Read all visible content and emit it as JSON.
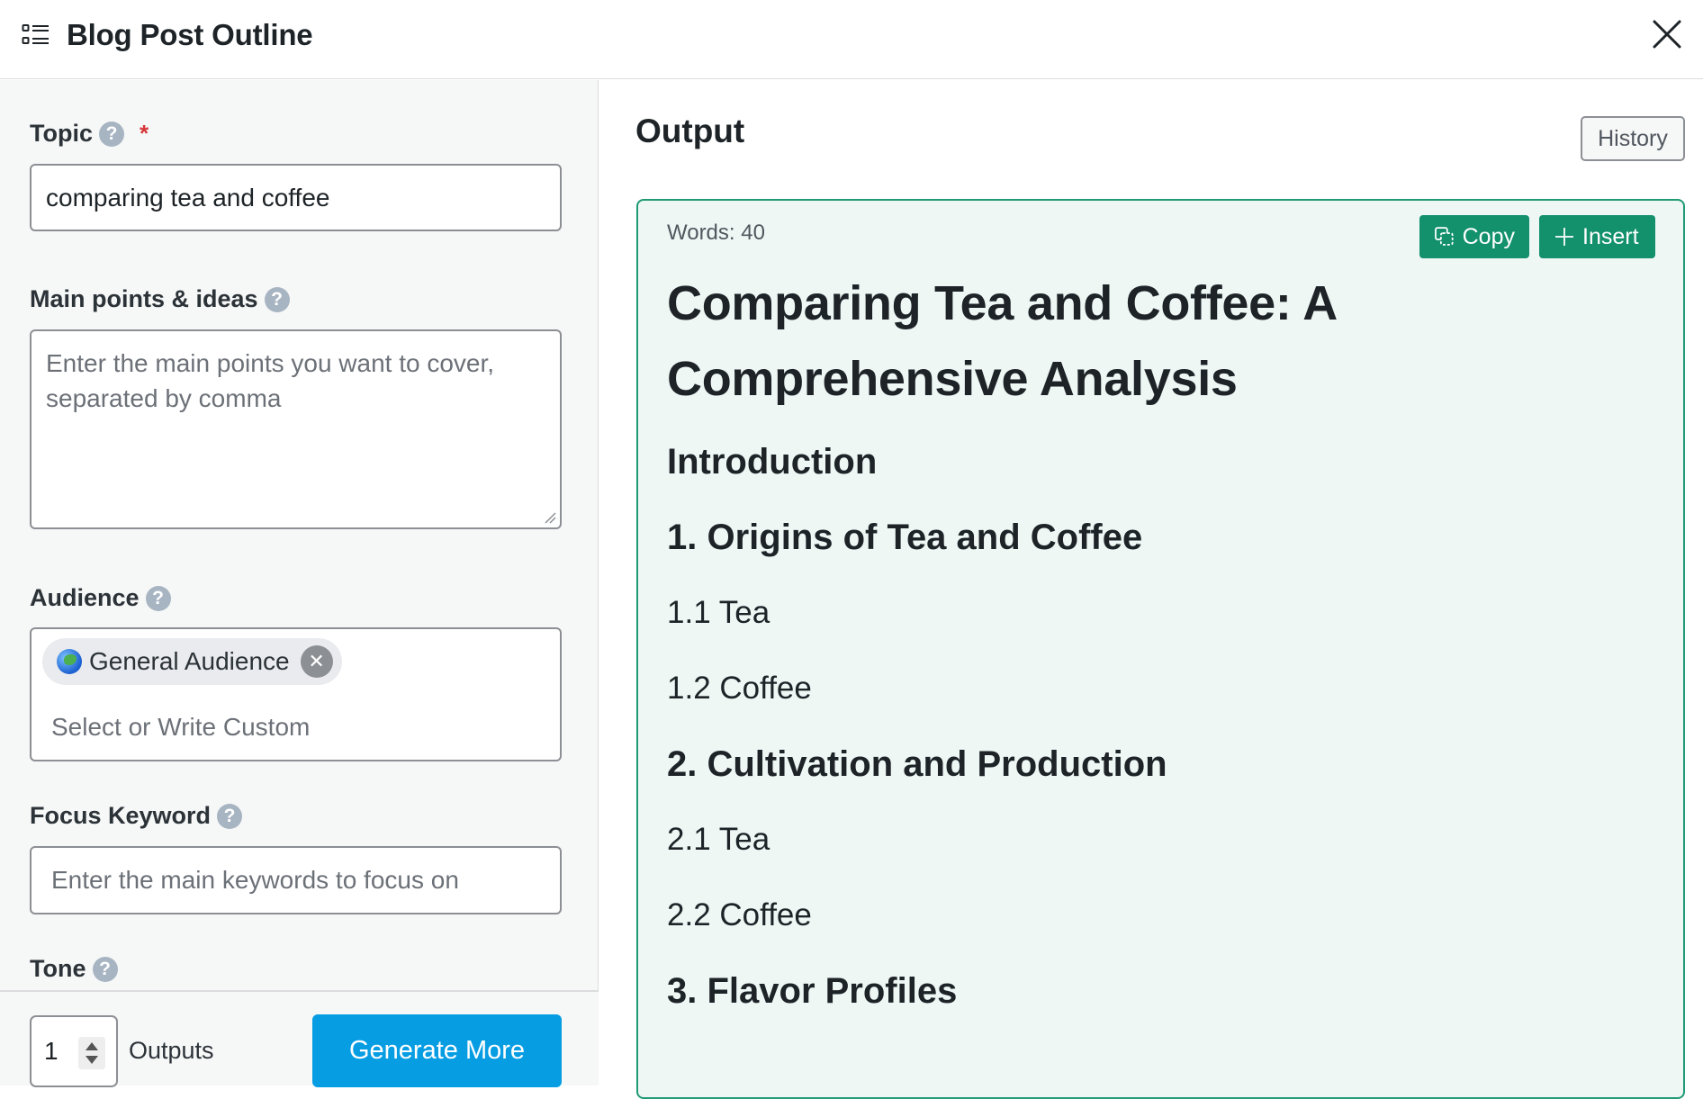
{
  "header": {
    "title": "Blog Post Outline",
    "icon": "list-icon",
    "close_icon": "close-icon"
  },
  "form": {
    "topic": {
      "label": "Topic",
      "required_mark": "*",
      "value": "comparing tea and coffee"
    },
    "main_points": {
      "label": "Main points & ideas",
      "placeholder": "Enter the main points you want to cover, separated by comma",
      "value": ""
    },
    "audience": {
      "label": "Audience",
      "selected": [
        {
          "icon": "globe-icon",
          "label": "General Audience"
        }
      ],
      "placeholder": "Select or Write Custom"
    },
    "focus_keyword": {
      "label": "Focus Keyword",
      "placeholder": "Enter the main keywords to focus on",
      "value": ""
    },
    "tone": {
      "label": "Tone"
    },
    "help_glyph": "?",
    "remove_glyph": "✕"
  },
  "bottom_bar": {
    "outputs_count": "1",
    "outputs_label": "Outputs",
    "generate_label": "Generate More",
    "generate_color": "#069de3"
  },
  "output": {
    "title": "Output",
    "history_label": "History",
    "word_count_label": "Words: 40",
    "copy_label": "Copy",
    "insert_label": "Insert",
    "accent_color": "#13906c",
    "document": {
      "title": "Comparing Tea and Coffee: A Comprehensive Analysis",
      "sections": [
        {
          "level": 2,
          "text": "Introduction"
        },
        {
          "level": 2,
          "text": "1. Origins of Tea and Coffee"
        },
        {
          "level": 3,
          "text": "1.1 Tea"
        },
        {
          "level": 3,
          "text": "1.2 Coffee"
        },
        {
          "level": 2,
          "text": "2. Cultivation and Production"
        },
        {
          "level": 3,
          "text": "2.1 Tea"
        },
        {
          "level": 3,
          "text": "2.2 Coffee"
        },
        {
          "level": 2,
          "text": "3. Flavor Profiles"
        }
      ]
    }
  }
}
